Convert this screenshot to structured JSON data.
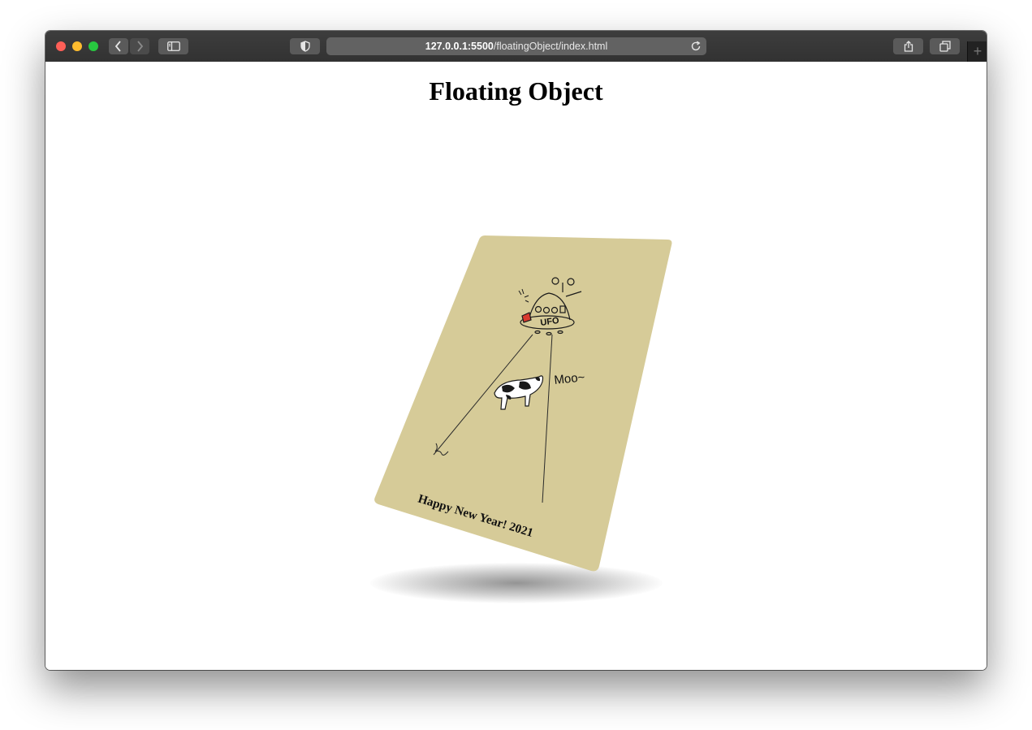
{
  "browser": {
    "url_host": "127.0.0.1:5500",
    "url_path": "/floatingObject/index.html"
  },
  "page": {
    "title": "Floating Object"
  },
  "card": {
    "greeting": "Happy New Year! 2021",
    "moo_text": "Moo~",
    "ufo_label": "UFO",
    "background_color": "#d6cb98"
  }
}
